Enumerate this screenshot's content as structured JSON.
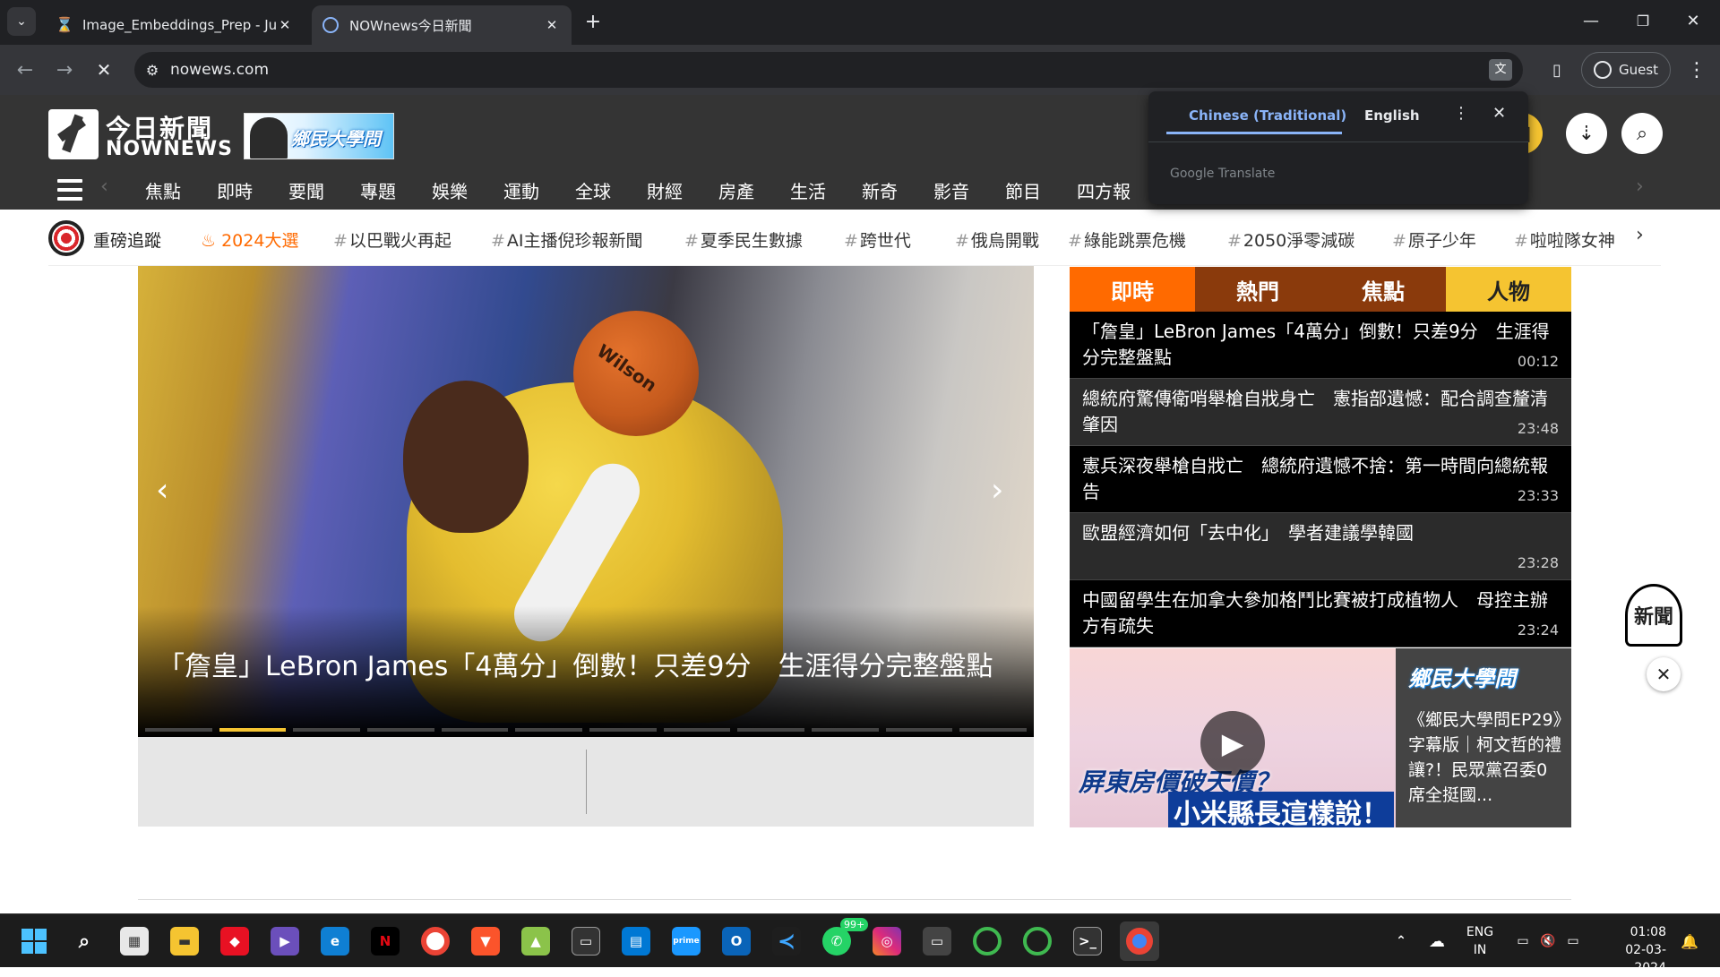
{
  "browser": {
    "tabs": [
      {
        "title": "Image_Embeddings_Prep - Jupy",
        "active": false
      },
      {
        "title": "NOWnews今日新聞",
        "active": true
      }
    ],
    "new_tab": "+",
    "url": "nowews.com",
    "profile": "Guest",
    "translate": {
      "lang_from": "Chinese (Traditional)",
      "lang_to": "English",
      "brand": "Google Translate"
    }
  },
  "site": {
    "logo_cn": "今日新聞",
    "logo_en": "NOWNEWS",
    "banner_text": "鄉民大學問",
    "nav": [
      "焦點",
      "即時",
      "要聞",
      "專題",
      "娛樂",
      "運動",
      "全球",
      "財經",
      "房產",
      "生活",
      "新奇",
      "影音",
      "節目",
      "四方報"
    ],
    "trending_label": "重磅追蹤",
    "trending": [
      "2024大選",
      "以巴戰火再起",
      "AI主播倪珍報新聞",
      "夏季民生數據",
      "跨世代",
      "俄烏開戰",
      "綠能跳票危機",
      "2050淨零減碳",
      "原子少年",
      "啦啦隊女神"
    ],
    "hero_caption": "「詹皇」LeBron James「4萬分」倒數！只差9分　生涯得分完整盤點",
    "sidebar_tabs": [
      "即時",
      "熱門",
      "焦點",
      "人物"
    ],
    "sidebar_tab_colors": [
      "#ff6a00",
      "#8a3a0c",
      "#8a3a0c",
      "#f5c431"
    ],
    "news": [
      {
        "title": "「詹皇」LeBron James「4萬分」倒數！只差9分　生涯得分完整盤點",
        "time": "00:12"
      },
      {
        "title": "總統府驚傳衛哨舉槍自戕身亡　憲指部遺憾：配合調查釐清肇因",
        "time": "23:48"
      },
      {
        "title": "憲兵深夜舉槍自戕亡　總統府遺憾不捨：第一時間向總統報告",
        "time": "23:33"
      },
      {
        "title": "歐盟經濟如何「去中化」　學者建議學韓國",
        "time": "23:28"
      },
      {
        "title": "中國留學生在加拿大參加格鬥比賽被打成植物人　母控主辦方有疏失",
        "time": "23:24"
      }
    ],
    "video": {
      "thumb_title1": "屏東房價破天價？",
      "thumb_title2": "小米縣長這樣說！",
      "side_logo": "鄉民大學問",
      "side_text": "《鄉民大學問EP29》字幕版｜柯文哲的禮讓?！民眾黨召委0席全挺國..."
    },
    "float_badge": "新聞"
  },
  "taskbar": {
    "lang1": "ENG",
    "lang2": "IN",
    "time": "01:08",
    "date": "02-03-2024",
    "badge": "99+"
  }
}
